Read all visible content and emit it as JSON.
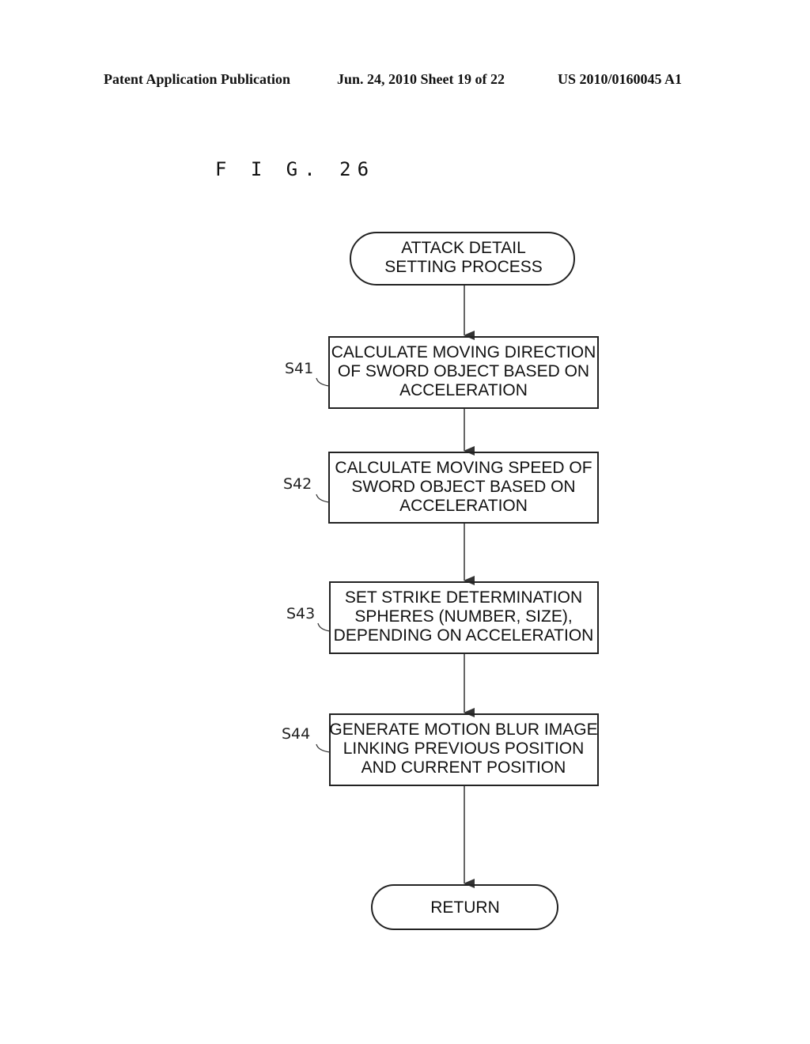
{
  "header": {
    "publication": "Patent Application Publication",
    "date_sheet": "Jun. 24, 2010  Sheet 19 of 22",
    "patent_number": "US 2010/0160045 A1"
  },
  "figure": {
    "label": "F I G. 26"
  },
  "flowchart": {
    "start": {
      "lines": [
        "ATTACK DETAIL",
        "SETTING PROCESS"
      ]
    },
    "steps": [
      {
        "id": "S41",
        "lines": [
          "CALCULATE MOVING DIRECTION",
          "OF SWORD OBJECT BASED ON",
          "ACCELERATION"
        ]
      },
      {
        "id": "S42",
        "lines": [
          "CALCULATE MOVING SPEED OF",
          "SWORD OBJECT BASED ON",
          "ACCELERATION"
        ]
      },
      {
        "id": "S43",
        "lines": [
          "SET STRIKE DETERMINATION",
          "SPHERES (NUMBER, SIZE),",
          "DEPENDING ON ACCELERATION"
        ]
      },
      {
        "id": "S44",
        "lines": [
          "GENERATE MOTION BLUR IMAGE",
          "LINKING PREVIOUS POSITION",
          "AND CURRENT POSITION"
        ]
      }
    ],
    "end": {
      "lines": [
        "RETURN"
      ]
    }
  }
}
